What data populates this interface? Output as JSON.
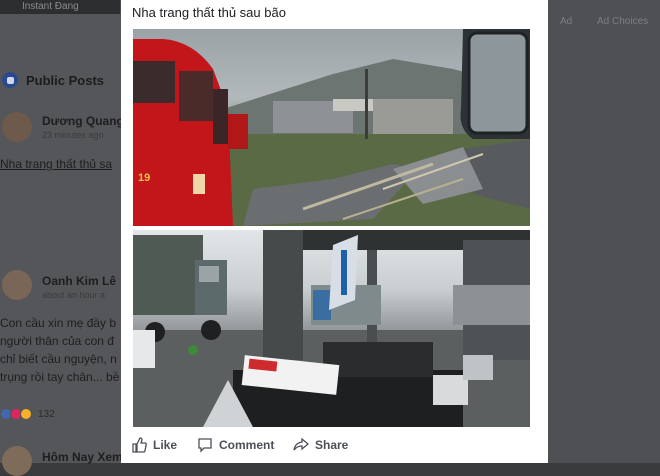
{
  "background": {
    "top_strip_text": "Instant Đang",
    "right_link_1": "Ad",
    "right_link_2": "Ad Choices",
    "section_title": "Public Posts",
    "post1": {
      "author": "Dương Quang",
      "meta": "23 minutes ago",
      "text": "Nha trang thất thủ sa"
    },
    "post2": {
      "author": "Oanh Kim Lê",
      "meta": "about an hour a",
      "lines": [
        "Con cầu xin mẹ đầy b",
        "người thân của con đ",
        "chỉ biết cầu nguyện, n",
        "trụng rồi tay chân... bề"
      ]
    },
    "reaction_count": "132",
    "post3": {
      "author": "Hôm Nay Xem"
    }
  },
  "post": {
    "caption": "Nha trang thất thủ sau bão"
  },
  "photos": [
    {
      "icon": "photo-bus-storm-damage"
    },
    {
      "icon": "photo-gas-station-damage"
    }
  ],
  "actions": {
    "like": "Like",
    "comment": "Comment",
    "share": "Share"
  },
  "colors": {
    "card": "#ffffff",
    "action_text": "#4b4f56",
    "overlay": "#4a4b4e"
  }
}
